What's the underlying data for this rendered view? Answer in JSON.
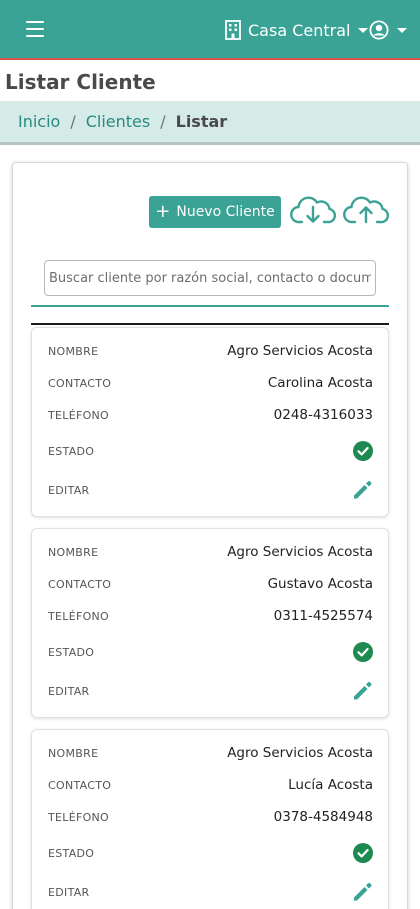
{
  "header": {
    "branch_label": "Casa Central",
    "menu_icon": "hamburger-icon",
    "branch_icon": "building-icon",
    "user_icon": "user-circle-icon",
    "accent_color": "#3aa396"
  },
  "page_title": "Listar Cliente",
  "breadcrumb": {
    "items": [
      "Inicio",
      "Clientes"
    ],
    "separator": "/",
    "current": "Listar"
  },
  "toolbar": {
    "new_button_label": "Nuevo Cliente",
    "new_button_icon": "plus-icon",
    "download_icon": "cloud-download-icon",
    "upload_icon": "cloud-upload-icon"
  },
  "search": {
    "placeholder": "Buscar cliente por razón social, contacto o documento",
    "value": ""
  },
  "labels": {
    "nombre": "NOMBRE",
    "contacto": "CONTACTO",
    "telefono": "TELÉFONO",
    "estado": "ESTADO",
    "editar": "EDITAR"
  },
  "clients": [
    {
      "nombre": "Agro Servicios Acosta",
      "contacto": "Carolina Acosta",
      "telefono": "0248-4316033",
      "estado": "activo"
    },
    {
      "nombre": "Agro Servicios Acosta",
      "contacto": "Gustavo Acosta",
      "telefono": "0311-4525574",
      "estado": "activo"
    },
    {
      "nombre": "Agro Servicios Acosta",
      "contacto": "Lucía Acosta",
      "telefono": "0378-4584948",
      "estado": "activo"
    }
  ],
  "status_color": "#1e8a52",
  "edit_icon": "pencil-icon"
}
